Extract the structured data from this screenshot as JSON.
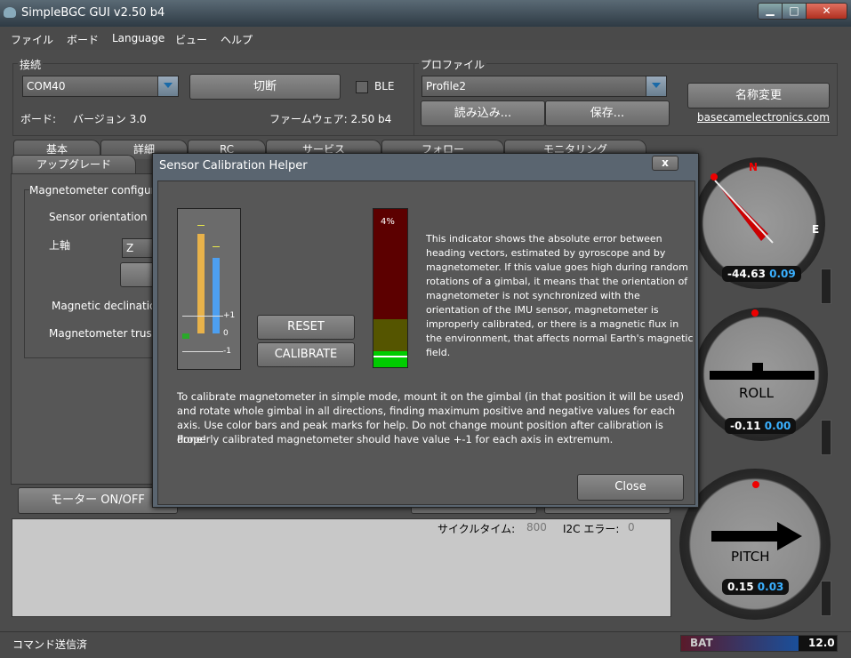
{
  "window": {
    "title": "SimpleBGC GUI v2.50 b4"
  },
  "menu": [
    "ファイル",
    "ボード",
    "Language",
    "ビュー",
    "ヘルプ"
  ],
  "connection": {
    "label": "接続",
    "port": "COM40",
    "disconnect_label": "切断",
    "ble_label": "BLE",
    "board_label": "ボード:",
    "board_version": "バージョン 3.0",
    "firmware": "ファームウェア: 2.50 b4"
  },
  "profile": {
    "label": "プロファイル",
    "selected": "Profile2",
    "load_label": "読み込み...",
    "save_label": "保存...",
    "rename_label": "名称変更",
    "link": "basecamelectronics.com"
  },
  "tabs": [
    "基本",
    "詳細",
    "RC",
    "サービス",
    "フォロー",
    "モニタリング",
    "アップグレード"
  ],
  "mag_panel": {
    "title": "Magnetometer configurati",
    "sensor_orientation": "Sensor orientation",
    "top_axis_label": "上軸",
    "top_axis_value": "Z",
    "declination": "Magnetic declination",
    "trust": "Magnetometer trust:"
  },
  "motor_label": "モーター ON/OFF",
  "cycle": {
    "label": "サイクルタイム:",
    "value": "800",
    "i2c_label": "I2C エラー:",
    "i2c_value": "0"
  },
  "status_bar": {
    "text": "コマンド送信済",
    "bat_label": "BAT",
    "bat_value": "12.0"
  },
  "gauges": {
    "heading": {
      "n": "N",
      "e": "E",
      "v1": "-44.63",
      "v2": "0.09"
    },
    "roll": {
      "label": "ROLL",
      "v1": "-0.11",
      "v2": "0.00"
    },
    "pitch": {
      "label": "PITCH",
      "v1": "0.15",
      "v2": "0.03"
    }
  },
  "dialog": {
    "title": "Sensor Calibration Helper",
    "close_x": "x",
    "axis_labels": [
      "+1",
      "0",
      "-1"
    ],
    "error_percent": "4%",
    "error_level": 0.04,
    "reset_label": "RESET",
    "calibrate_label": "CALIBRATE",
    "indicator_text": "This indicator shows the absolute error between heading vectors, estimated by gyroscope and by magnetometer. If this value goes high during random rotations of a gimbal, it means that the orientation of magnetometer is not synchronized with the orientation of the IMU sensor, magnetometer is improperly calibrated, or there is a magnetic flux in the environment, that affects normal Earth's magnetic field.",
    "instructions_1": "To calibrate magnetometer in simple mode, mount it on the gimbal (in that position it will be used) and rotate whole gimbal in all directions, finding maximum positive and negative values for each axis. Use color bars and peak marks for help. Do not change mount position after calibration is done!",
    "instructions_2": "Properly calibrated magnetometer should have value +-1 for each axis in extremum.",
    "close_label": "Close"
  },
  "colors": {
    "bar_x": "#e8b24a",
    "bar_y": "#4d9ff0",
    "bar_z": "#2aa82a",
    "error_red": "#5c0000",
    "error_olive": "#555500",
    "error_green": "#00cc00"
  }
}
